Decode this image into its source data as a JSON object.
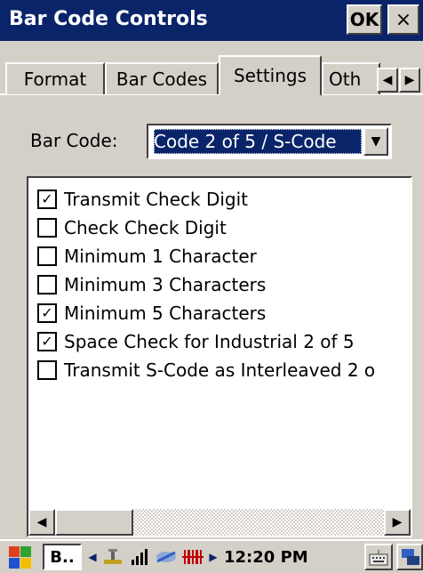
{
  "window": {
    "title": "Bar Code Controls",
    "ok_label": "OK",
    "close_label": "×"
  },
  "tabs": [
    {
      "label": "Format",
      "active": false
    },
    {
      "label": "Bar Codes",
      "active": false
    },
    {
      "label": "Settings",
      "active": true
    },
    {
      "label": "Oth",
      "active": false
    }
  ],
  "tab_scroll": {
    "left_icon": "◀",
    "right_icon": "▶"
  },
  "barcode": {
    "label": "Bar Code:",
    "selected": "Code 2 of 5 / S-Code",
    "dropdown_icon": "▼"
  },
  "options": [
    {
      "label": "Transmit Check Digit",
      "checked": true
    },
    {
      "label": "Check Check Digit",
      "checked": false
    },
    {
      "label": "Minimum 1 Character",
      "checked": false
    },
    {
      "label": "Minimum 3 Characters",
      "checked": false
    },
    {
      "label": "Minimum 5 Characters",
      "checked": true
    },
    {
      "label": "Space Check for Industrial 2 of 5",
      "checked": true
    },
    {
      "label": "Transmit S-Code as Interleaved 2 o",
      "checked": false
    }
  ],
  "scrollbar": {
    "left_icon": "◀",
    "right_icon": "▶"
  },
  "taskbar": {
    "task_label": "B..",
    "tray_arrow": "◀",
    "tray_arrow_right": "▶",
    "clock": "12:20 PM",
    "icons": [
      "windows-start-icon",
      "usb-icon",
      "signal-bars-icon",
      "connection-icon",
      "barcode-scanner-icon",
      "keyboard-icon",
      "network-icon"
    ]
  },
  "colors": {
    "titlebar": "#0a246a",
    "face": "#d4d0c8",
    "selection": "#0a246a"
  }
}
